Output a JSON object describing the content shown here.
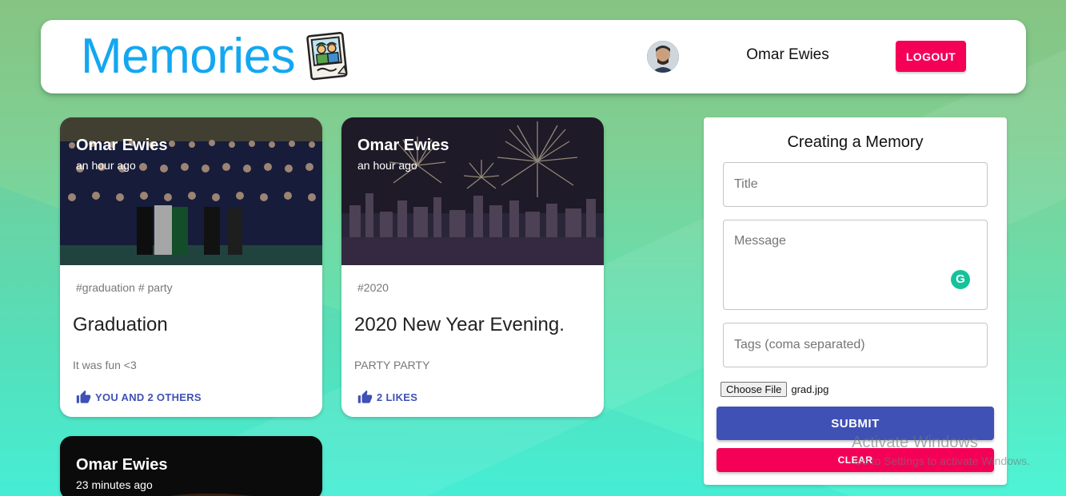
{
  "header": {
    "brand": "Memories",
    "logo_icon": "memories-photo-icon",
    "user_name": "Omar Ewies",
    "logout_label": "LOGOUT",
    "accent_color": "#13a7f0"
  },
  "posts": [
    {
      "author": "Omar Ewies",
      "time": "an hour ago",
      "tags": "#graduation # party",
      "title": "Graduation",
      "message": "It was fun <3",
      "likes_label": "YOU AND 2 OTHERS",
      "image": "graduation-group-photo"
    },
    {
      "author": "Omar Ewies",
      "time": "an hour ago",
      "tags": "#2020",
      "title": "2020 New Year Evening.",
      "message": "PARTY PARTY",
      "likes_label": "2 LIKES",
      "image": "fireworks-city-photo"
    },
    {
      "author": "Omar Ewies",
      "time": "23 minutes ago",
      "image": "dark-car-photo"
    }
  ],
  "form": {
    "title": "Creating a Memory",
    "title_placeholder": "Title",
    "message_placeholder": "Message",
    "tags_placeholder": "Tags (coma separated)",
    "file_button_label": "Choose File",
    "file_name": "grad.jpg",
    "submit_label": "SUBMIT",
    "clear_label": "CLEAR"
  },
  "watermark": {
    "line1": "Activate Windows",
    "line2": "Go to Settings to activate Windows."
  }
}
